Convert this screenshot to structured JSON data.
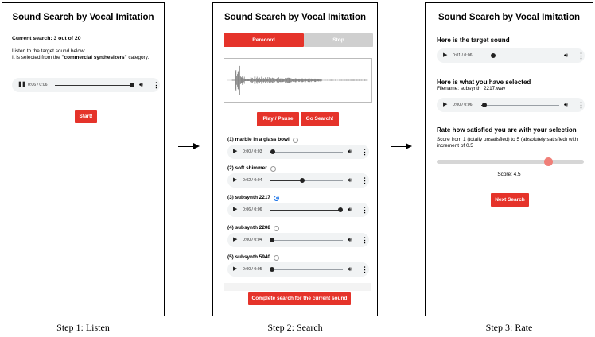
{
  "app_title": "Sound Search by Vocal Imitation",
  "step1": {
    "current_search": "Current search: 3 out of 20",
    "instruction_line1": "Listen to the target sound below:",
    "instruction_prefix": "It is selected from the ",
    "category": "\"commercial synthesizers\"",
    "instruction_suffix": " category.",
    "player_time": "0:06 / 0:06",
    "player_progress": 0.97,
    "start_label": "Start!",
    "caption": "Step 1: Listen"
  },
  "step2": {
    "rerecord_label": "Rerecord",
    "stop_label": "Stop",
    "play_pause_label": "Play / Pause",
    "go_search_label": "Go Search!",
    "results": [
      {
        "label": "(1) marble in a glass bowl",
        "time": "0:00 / 0:03",
        "progress": 0.04,
        "selected": false
      },
      {
        "label": "(2) soft shimmer",
        "time": "0:02 / 0:04",
        "progress": 0.45,
        "selected": false
      },
      {
        "label": "(3) subsynth 2217",
        "time": "0:06 / 0:06",
        "progress": 0.97,
        "selected": true
      },
      {
        "label": "(4) subsynth 2208",
        "time": "0:00 / 0:04",
        "progress": 0.03,
        "selected": false
      },
      {
        "label": "(5) subsynth 5940",
        "time": "0:00 / 0:05",
        "progress": 0.03,
        "selected": false
      }
    ],
    "complete_label": "Complete search for the current sound",
    "caption": "Step 2: Search"
  },
  "step3": {
    "target_heading": "Here is the target sound",
    "target_time": "0:01 / 0:06",
    "target_progress": 0.15,
    "selected_heading": "Here is what you have selected",
    "filename": "Filename: subsynth_2217.wav",
    "selected_time": "0:00 / 0:06",
    "selected_progress": 0.04,
    "rate_heading": "Rate how satisfied you are with your selection",
    "rate_description": "Score from 1 (totally unsatisfied) to 5 (absolutely satisfied) with increment of 0.5",
    "score_text": "Score: 4.5",
    "score_value": 4.5,
    "score_min": 1,
    "score_max": 5,
    "next_label": "Next Search",
    "caption": "Step 3: Rate"
  },
  "icons": {
    "play": "play-icon",
    "pause": "pause-icon",
    "volume": "volume-icon",
    "more": "more-vert-icon",
    "arrow": "arrow-right-icon"
  }
}
